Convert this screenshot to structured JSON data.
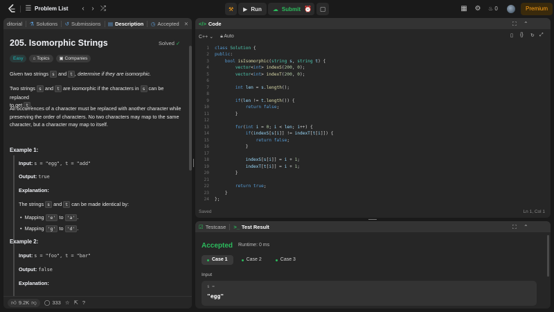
{
  "topbar": {
    "problem_list": "Problem List",
    "run_label": "Run",
    "submit_label": "Submit",
    "streak_count": "0",
    "premium_label": "Premium"
  },
  "left_panel": {
    "tabs": [
      {
        "label": "ditorial"
      },
      {
        "label": "Solutions"
      },
      {
        "label": "Submissions"
      },
      {
        "label": "Description"
      },
      {
        "label": "Accepted"
      }
    ],
    "title": "205. Isomorphic Strings",
    "solved": "Solved",
    "badges": [
      "Easy",
      "Topics",
      "Companies"
    ],
    "desc1_a": "Given two strings ",
    "desc1_s": "s",
    "desc1_b": " and ",
    "desc1_t": "t",
    "desc1_c": ", determine if they are isomorphic.",
    "desc2_a": "Two strings ",
    "desc2_s": "s",
    "desc2_b": " and ",
    "desc2_t": "t",
    "desc2_c": " are isomorphic if the characters in ",
    "desc2_s2": "s",
    "desc2_d": " can be replaced",
    "desc2_e": "to get ",
    "desc2_t2": "t",
    "desc2_f": ".",
    "desc3_l1": "All occurrences of a character must be replaced with another character while",
    "desc3_l2": "preserving the order of characters. No two characters may map to the same",
    "desc3_l3": "character, but a character may map to itself.",
    "example1": {
      "title": "Example 1:",
      "input_label": "Input:",
      "input_value": "s = \"egg\", t = \"add\"",
      "output_label": "Output:",
      "output_value": "true",
      "explanation_label": "Explanation:",
      "exp_a": "The strings ",
      "exp_s": "s",
      "exp_b": " and ",
      "exp_t": "t",
      "exp_c": " can be made identical by:",
      "m1_a": "Mapping ",
      "m1_from": "'e'",
      "m1_to_word": " to ",
      "m1_to": "'a'",
      "m1_end": ".",
      "m2_a": "Mapping ",
      "m2_from": "'g'",
      "m2_to_word": " to ",
      "m2_to": "'d'",
      "m2_end": "."
    },
    "example2": {
      "title": "Example 2:",
      "input_label": "Input:",
      "input_value": "s = \"foo\", t = \"bar\"",
      "output_label": "Output:",
      "output_value": "false",
      "explanation_label": "Explanation:"
    },
    "footer": {
      "likes": "9.2K",
      "comments": "333"
    }
  },
  "code_panel": {
    "title": "Code",
    "language": "C++",
    "mode": "Auto",
    "saved": "Saved",
    "cursor": "Ln 1, Col 1",
    "line_numbers": [
      "1",
      "2",
      "3",
      "4",
      "5",
      "6",
      "7",
      "8",
      "9",
      "10",
      "11",
      "12",
      "13",
      "14",
      "15",
      "16",
      "17",
      "18",
      "19",
      "20",
      "21",
      "22",
      "23",
      "24"
    ]
  },
  "test_panel": {
    "tab_testcase": "Testcase",
    "tab_result": "Test Result",
    "status": "Accepted",
    "runtime": "Runtime: 0 ms",
    "cases": [
      "Case 1",
      "Case 2",
      "Case 3"
    ],
    "input_label": "Input",
    "input_var": "s =",
    "input_value": "\"egg\""
  },
  "colors": {
    "accent_green": "#2cbb5d",
    "premium": "#ffa116",
    "easy": "#1cbaba"
  }
}
